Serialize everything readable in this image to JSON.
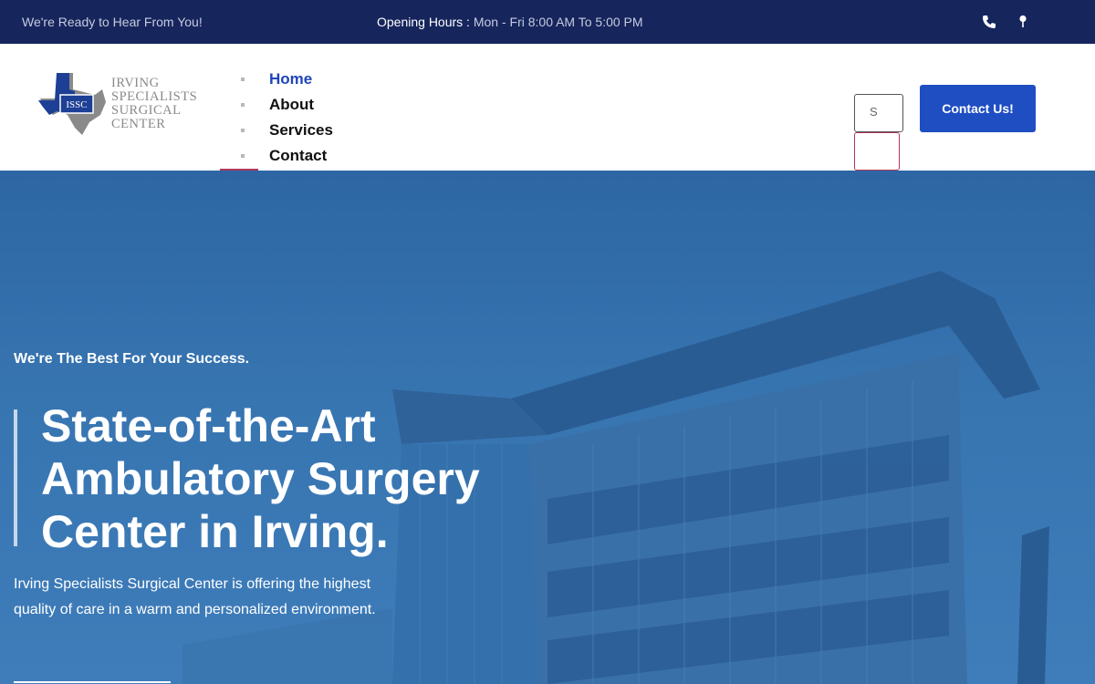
{
  "topbar": {
    "tagline": "We're Ready to Hear From You!",
    "hours_label": "Opening Hours : ",
    "hours_value": "Mon - Fri 8:00 AM To 5:00 PM",
    "icons": [
      "phone-icon",
      "map-pin-icon"
    ]
  },
  "header": {
    "logo": {
      "initials": "ISSC",
      "line1": "IRVING",
      "line2": "SPECIALISTS",
      "line3": "SURGICAL",
      "line4": "CENTER"
    },
    "nav": [
      {
        "label": "Home",
        "active": true
      },
      {
        "label": "About",
        "active": false
      },
      {
        "label": "Services",
        "active": false
      },
      {
        "label": "Contact",
        "active": false
      }
    ],
    "search_text": "S",
    "contact_button": "Contact Us!"
  },
  "hero": {
    "eyebrow": "We're The Best For Your Success.",
    "title_line1": "State-of-the-Art",
    "title_line2": "Ambulatory Surgery",
    "title_line3": "Center in Irving.",
    "desc_line1": "Irving Specialists Surgical Center is offering the highest",
    "desc_line2": "quality of care in a warm and personalized environment."
  },
  "colors": {
    "topbar_bg": "#16255c",
    "accent_blue": "#1f4ec3",
    "active_nav": "#2045b8",
    "underline_accent": "#b0385a",
    "hero_overlay": "#2d66a3"
  }
}
